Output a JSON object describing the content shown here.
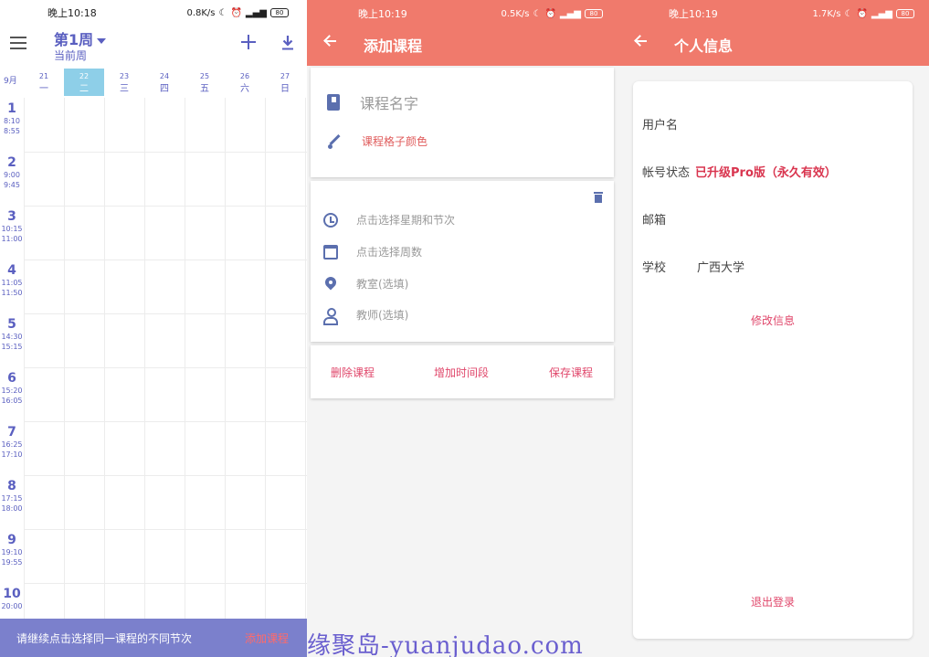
{
  "panel_timetable": {
    "status": {
      "time": "晚上10:18",
      "speed": "0.8K/s",
      "battery": "80"
    },
    "week_title": "第1周",
    "week_sub": "当前周",
    "month": "9月",
    "days": [
      {
        "num": "21",
        "name": "一"
      },
      {
        "num": "22",
        "name": "二"
      },
      {
        "num": "23",
        "name": "三"
      },
      {
        "num": "24",
        "name": "四"
      },
      {
        "num": "25",
        "name": "五"
      },
      {
        "num": "26",
        "name": "六"
      },
      {
        "num": "27",
        "name": "日"
      }
    ],
    "active_day_index": 1,
    "periods": [
      {
        "n": "1",
        "start": "8:10",
        "end": "8:55"
      },
      {
        "n": "2",
        "start": "9:00",
        "end": "9:45"
      },
      {
        "n": "3",
        "start": "10:15",
        "end": "11:00"
      },
      {
        "n": "4",
        "start": "11:05",
        "end": "11:50"
      },
      {
        "n": "5",
        "start": "14:30",
        "end": "15:15"
      },
      {
        "n": "6",
        "start": "15:20",
        "end": "16:05"
      },
      {
        "n": "7",
        "start": "16:25",
        "end": "17:10"
      },
      {
        "n": "8",
        "start": "17:15",
        "end": "18:00"
      },
      {
        "n": "9",
        "start": "19:10",
        "end": "19:55"
      },
      {
        "n": "10",
        "start": "20:00",
        "end": ""
      }
    ],
    "snackbar": {
      "text": "请继续点击选择同一课程的不同节次",
      "action": "添加课程"
    }
  },
  "panel_add_course": {
    "status": {
      "time": "晚上10:19",
      "speed": "0.5K/s",
      "battery": "80"
    },
    "title": "添加课程",
    "course_name_placeholder": "课程名字",
    "color_label": "课程格子颜色",
    "fields": {
      "weekday_period": "点击选择星期和节次",
      "weeks": "点击选择周数",
      "classroom": "教室(选填)",
      "teacher": "教师(选填)"
    },
    "buttons": {
      "delete": "删除课程",
      "add_time": "增加时间段",
      "save": "保存课程"
    }
  },
  "panel_profile": {
    "status": {
      "time": "晚上10:19",
      "speed": "1.7K/s",
      "battery": "80"
    },
    "title": "个人信息",
    "username_label": "用户名",
    "account_status_label": "帐号状态",
    "account_status_value": "已升级Pro版（永久有效）",
    "email_label": "邮箱",
    "school_label": "学校",
    "school_value": "广西大学",
    "edit_link": "修改信息",
    "logout_link": "退出登录"
  },
  "watermark": "缘聚岛-yuanjudao.com",
  "colors": {
    "accent": "#5a5fc0",
    "coral": "#f07a6c",
    "pink": "#e0476b",
    "snackbar": "#7b80cc",
    "today": "#8ecfe8"
  }
}
